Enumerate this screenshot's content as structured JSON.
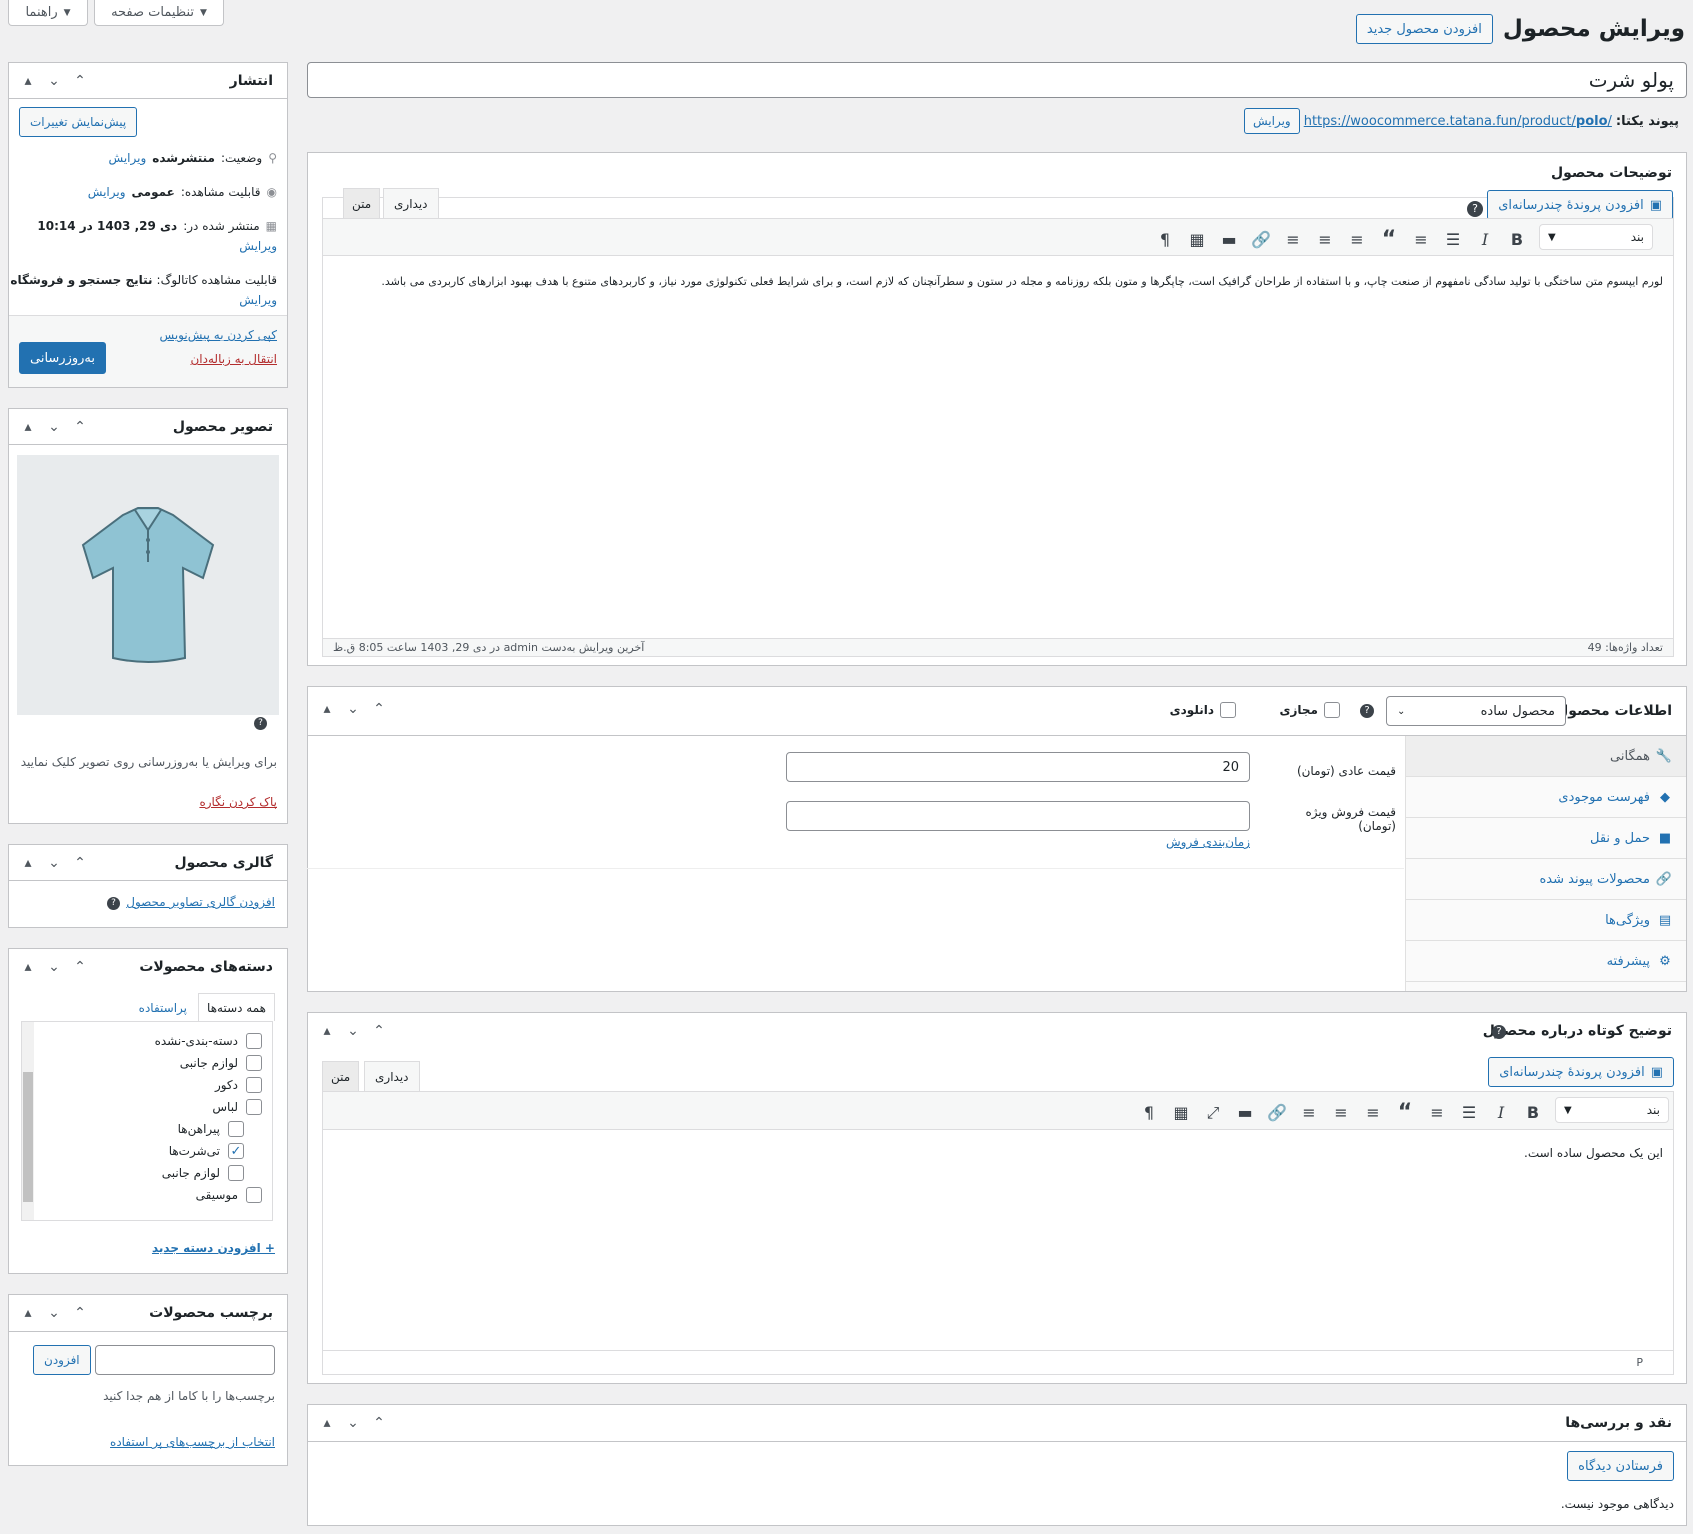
{
  "header": {
    "title": "ویرایش محصول",
    "add_new": "افزودن محصول جدید",
    "screen_options": "تنظیمات صفحه",
    "help": "راهنما"
  },
  "product": {
    "title": "پولو شرت",
    "permalink_label": "پیوند یکتا:",
    "permalink_base": "https://woocommerce.tatana.fun/product/",
    "permalink_slug": "polo",
    "permalink_end": "/",
    "permalink_edit": "ویرایش"
  },
  "description": {
    "title": "توضیحات محصول",
    "add_media": "افزودن پروندهٔ چندرسانه‌ای",
    "tab_visual": "دیداری",
    "tab_text": "متن",
    "format": "بند",
    "content": "لورم ایپسوم متن ساختگی با تولید سادگی نامفهوم از صنعت چاپ، و با استفاده از طراحان گرافیک است، چاپگرها و متون بلکه روزنامه و مجله در ستون و سطرآنچنان که لازم است، و برای شرایط فعلی تکنولوژی مورد نیاز، و کاربردهای متنوع با هدف بهبود ابزارهای کاربردی می باشد.",
    "word_count": "تعداد واژه‌ها: 49",
    "last_edit": "آخرین ویرایش به‌دست admin در دی 29, 1403 ساعت 8:05 ق.ظ"
  },
  "product_data": {
    "title": "اطلاعات محصول —",
    "type": "محصول ساده",
    "virtual": "مجازی",
    "downloadable": "دانلودی",
    "tabs": [
      {
        "label": "همگانی",
        "icon": "wrench-icon"
      },
      {
        "label": "فهرست موجودی",
        "icon": "tag-icon"
      },
      {
        "label": "حمل و نقل",
        "icon": "truck-icon"
      },
      {
        "label": "محصولات پیوند شده",
        "icon": "link-icon"
      },
      {
        "label": "ویژگی‌ها",
        "icon": "list-icon"
      },
      {
        "label": "پیشرفته",
        "icon": "gear-icon"
      }
    ],
    "regular_price_label": "قیمت عادی (تومان)",
    "regular_price": "20",
    "sale_price_label": "قیمت فروش ویژه (تومان)",
    "sale_price": "",
    "schedule": "زمان‌بندی فروش"
  },
  "short_description": {
    "title": "توضیح کوتاه درباره محصول",
    "add_media": "افزودن پروندهٔ چندرسانه‌ای",
    "tab_visual": "دیداری",
    "tab_text": "متن",
    "format": "بند",
    "content": "این یک محصول ساده است.",
    "path": "P"
  },
  "reviews": {
    "title": "نقد و بررسی‌ها",
    "submit": "فرستادن دیدگاه",
    "empty": "دیدگاهی موجود نیست."
  },
  "publish": {
    "title": "انتشار",
    "preview": "پیش‌نمایش تغییرات",
    "status_label": "وضعیت:",
    "status": "منتشرشده",
    "edit": "ویرایش",
    "visibility_label": "قابلیت مشاهده:",
    "visibility": "عمومی",
    "published_label": "منتشر شده در:",
    "published": "دی 29, 1403 در 10:14",
    "catalog_label": "قابلیت مشاهده کاتالوگ:",
    "catalog": "نتایج جستجو و فروشگاه",
    "copy_draft": "کپی کردن به پیش‌نویس",
    "trash": "انتقال به زباله‌دان",
    "update": "به‌روزرسانی"
  },
  "image": {
    "title": "تصویر محصول",
    "hint": "برای ویرایش یا به‌روزرسانی روی تصویر کلیک نمایید",
    "remove": "پاک کردن نگاره"
  },
  "gallery": {
    "title": "گالری محصول",
    "add": "افزودن گالری تصاویر محصول"
  },
  "categories": {
    "title": "دسته‌های محصولات",
    "tab_all": "همه دسته‌ها",
    "tab_popular": "پراستفاده",
    "items": [
      {
        "label": "دسته-بندی-نشده",
        "checked": false,
        "child": false
      },
      {
        "label": "لوازم جانبی",
        "checked": false,
        "child": false
      },
      {
        "label": "دکور",
        "checked": false,
        "child": false
      },
      {
        "label": "لباس",
        "checked": false,
        "child": false
      },
      {
        "label": "پیراهن‌ها",
        "checked": false,
        "child": true
      },
      {
        "label": "تی‌شرت‌ها",
        "checked": true,
        "child": true
      },
      {
        "label": "لوازم جانبی",
        "checked": false,
        "child": true
      },
      {
        "label": "موسیقی",
        "checked": false,
        "child": false
      }
    ],
    "add_new": "+ افزودن دسته جدید"
  },
  "tags": {
    "title": "برچسب محصولات",
    "add": "افزودن",
    "hint": "برچسب‌ها را با کاما از هم جدا کنید",
    "choose": "انتخاب از برچسب‌های پر استفاده"
  },
  "colors": {
    "accent": "#2271b1",
    "trash": "#b32d2e",
    "bg": "#f0f0f1"
  }
}
